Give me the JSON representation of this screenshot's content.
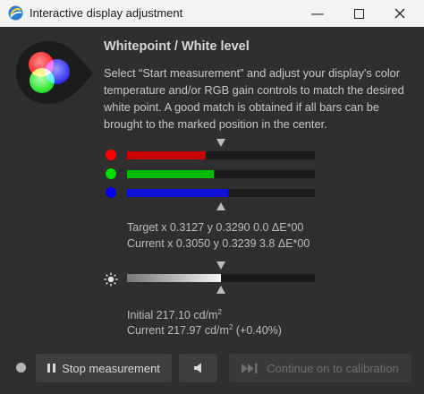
{
  "window": {
    "title": "Interactive display adjustment",
    "minimize_glyph": "—"
  },
  "icons": {
    "app": "displaycal-icon",
    "logo": "rgb-light-icon",
    "red": "red-channel-icon",
    "green": "green-channel-icon",
    "blue": "blue-channel-icon",
    "luminance": "sun-icon",
    "sound": "speaker-icon"
  },
  "colors": {
    "red": "#ff0000",
    "green": "#00dd00",
    "blue": "#0000ee",
    "red_bar": "#c80000",
    "green_bar": "#00bb00",
    "blue_bar": "#1010d8"
  },
  "heading": "Whitepoint / White level",
  "instructions": "Select “Start measurement” and adjust your display's color temperature and/or RGB gain controls to match the desired white point. A good match is obtained if all bars can be brought to the marked position in the center.",
  "rgb_levels": {
    "red": 0.42,
    "green": 0.46,
    "blue": 0.54,
    "target": 0.5
  },
  "readout": {
    "target": "Target x 0.3127 y 0.3290 0.0 ΔE*00",
    "current": "Current x 0.3050 y 0.3239 3.8 ΔE*00"
  },
  "luminance": {
    "level": 0.5,
    "initial_prefix": "Initial 217.10 cd/m",
    "current_prefix": "Current 217.97 cd/m",
    "exponent": "2",
    "current_suffix": " (+0.40%)"
  },
  "buttons": {
    "stop": "Stop measurement",
    "continue": "Continue on to calibration"
  }
}
